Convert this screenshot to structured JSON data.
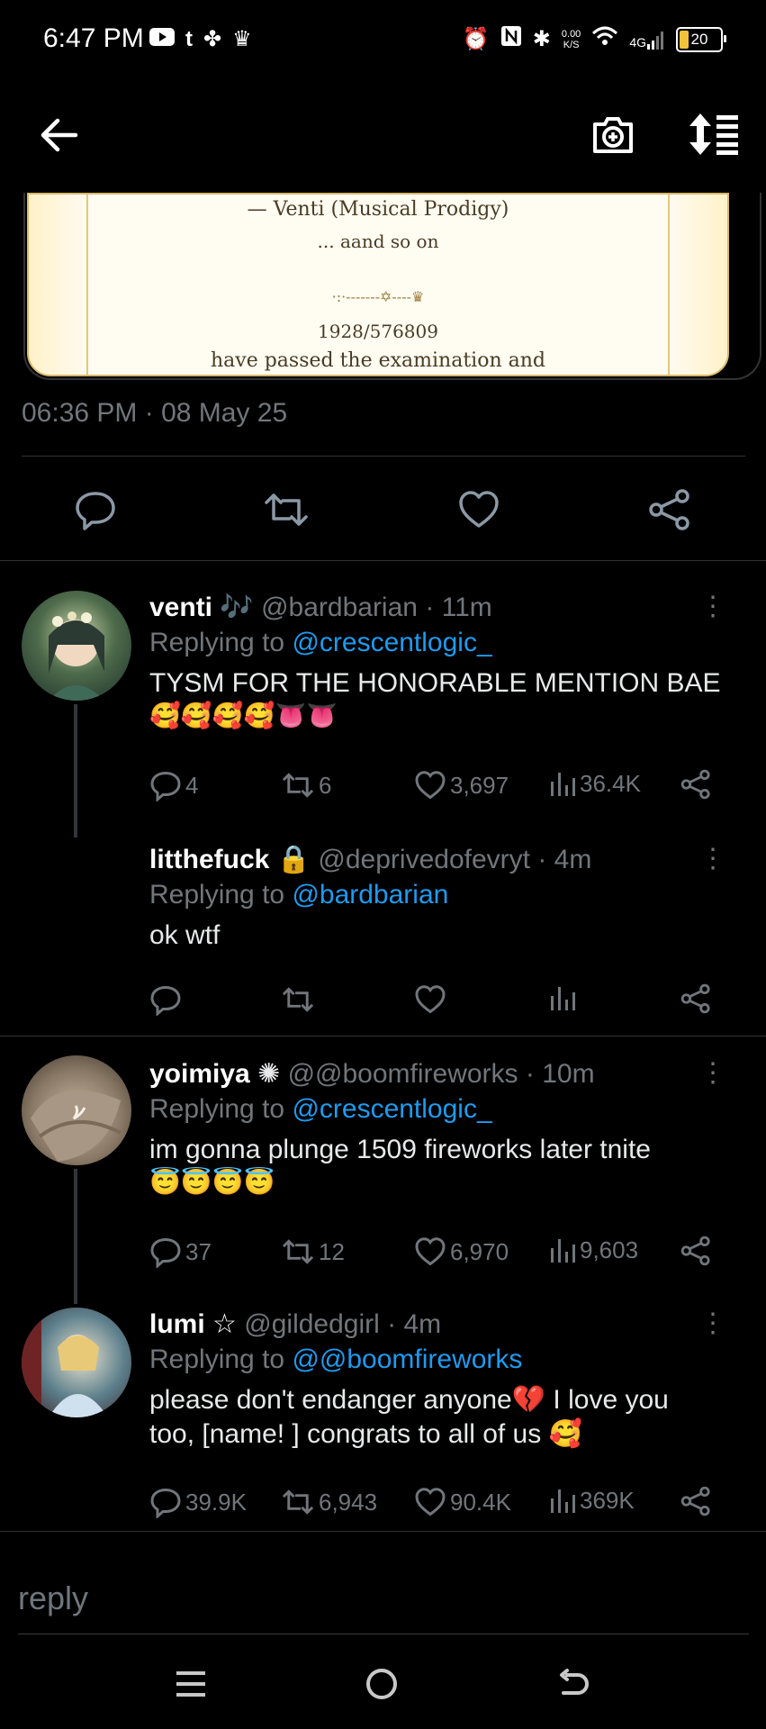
{
  "status_bar": {
    "time": "6:47 PM",
    "net_speed_value": "0.00",
    "net_speed_unit": "K/S",
    "network": "4G",
    "battery": "20"
  },
  "image_card": {
    "line1": "— Venti (Musical Prodigy)",
    "line2": "... aand so on",
    "ornament": "·:·-------✡----♛",
    "line3": "1928/576809",
    "line4": "have passed the examination and"
  },
  "main_tweet": {
    "timestamp": "06:36 PM · 08 May 25"
  },
  "replies": [
    {
      "name": "venti",
      "badge": "🎶",
      "handle": "@bardbarian",
      "time": "· 11m",
      "replying_label": "Replying to",
      "replying_to": "@crescentlogic_",
      "text": "TYSM FOR THE HONORABLE MENTION BAE",
      "emoji": "🥰🥰🥰🥰👅👅",
      "replies": "4",
      "retweets": "6",
      "likes": "3,697",
      "views": "36.4K"
    },
    {
      "name": "litthefuck",
      "badge": "🔒",
      "handle": "@deprivedofevryt",
      "time": "· 4m",
      "replying_label": "Replying to",
      "replying_to": "@bardbarian",
      "text": "ok wtf"
    },
    {
      "name": "yoimiya",
      "badge": "✺",
      "handle": "@@boomfireworks",
      "time": "· 10m",
      "replying_label": "Replying to",
      "replying_to": "@crescentlogic_",
      "text": "im gonna plunge 1509 fireworks later tnite",
      "emoji": "😇😇😇😇",
      "replies": "37",
      "retweets": "12",
      "likes": "6,970",
      "views": "9,603"
    },
    {
      "name": "lumi",
      "badge": "☆",
      "handle": "@gildedgirl",
      "time": "· 4m",
      "replying_label": "Replying to",
      "replying_to": "@@boomfireworks",
      "text_line1": "please don't endanger anyone💔 I love you",
      "text_line2": "too, [name! ] congrats to all of us 🥰",
      "replies": "39.9K",
      "retweets": "6,943",
      "likes": "90.4K",
      "views": "369K"
    }
  ],
  "composer": {
    "placeholder": "reply"
  },
  "colors": {
    "background": "#000000",
    "accent": "#1d9bf0",
    "muted": "#71767b"
  }
}
